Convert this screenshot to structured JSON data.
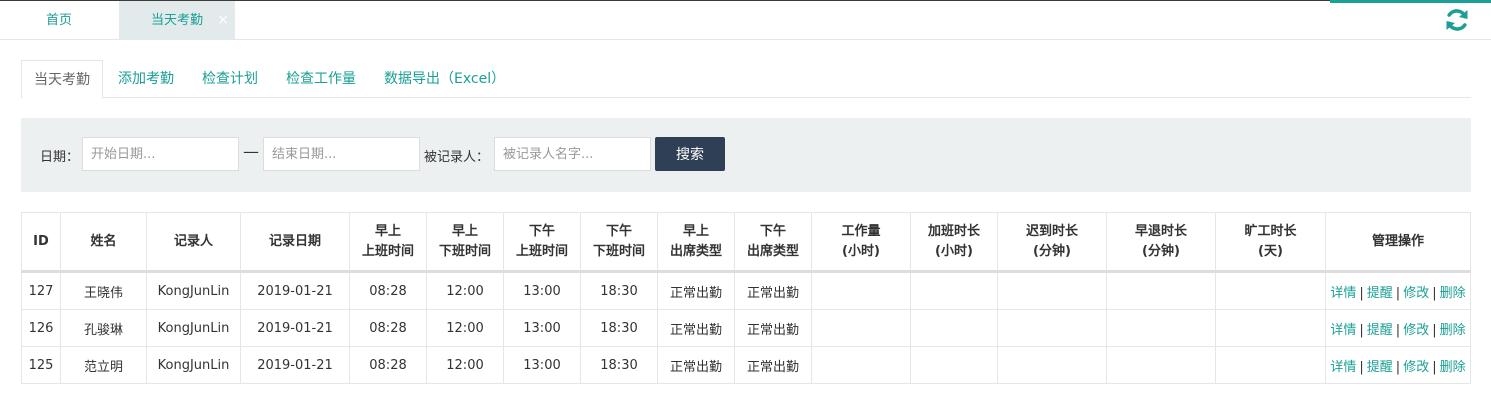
{
  "top_tabs": [
    {
      "label": "首页"
    },
    {
      "label": "当天考勤",
      "close": "×"
    }
  ],
  "sub_tabs": [
    "当天考勤",
    "添加考勤",
    "检查计划",
    "检查工作量",
    "数据导出（Excel）"
  ],
  "search": {
    "date_label": "日期：",
    "start_placeholder": "开始日期...",
    "dash": "—",
    "end_placeholder": "结束日期...",
    "person_label": "被记录人：",
    "person_placeholder": "被记录人名字...",
    "button": "搜索"
  },
  "table": {
    "headers": [
      {
        "l1": "ID",
        "l2": ""
      },
      {
        "l1": "姓名",
        "l2": ""
      },
      {
        "l1": "记录人",
        "l2": ""
      },
      {
        "l1": "记录日期",
        "l2": ""
      },
      {
        "l1": "早上",
        "l2": "上班时间"
      },
      {
        "l1": "早上",
        "l2": "下班时间"
      },
      {
        "l1": "下午",
        "l2": "上班时间"
      },
      {
        "l1": "下午",
        "l2": "下班时间"
      },
      {
        "l1": "早上",
        "l2": "出席类型"
      },
      {
        "l1": "下午",
        "l2": "出席类型"
      },
      {
        "l1": "工作量",
        "l2": "(小时)"
      },
      {
        "l1": "加班时长",
        "l2": "(小时)"
      },
      {
        "l1": "迟到时长",
        "l2": "(分钟)"
      },
      {
        "l1": "早退时长",
        "l2": "(分钟)"
      },
      {
        "l1": "旷工时长",
        "l2": "(天)"
      },
      {
        "l1": "管理操作",
        "l2": ""
      }
    ],
    "rows": [
      {
        "id": "127",
        "name": "王晓伟",
        "recorder": "KongJunLin",
        "date": "2019-01-21",
        "am_in": "08:28",
        "am_out": "12:00",
        "pm_in": "13:00",
        "pm_out": "18:30",
        "am_type": "正常出勤",
        "pm_type": "正常出勤",
        "work": "",
        "overtime": "",
        "late": "",
        "early": "",
        "absent": ""
      },
      {
        "id": "126",
        "name": "孔骏琳",
        "recorder": "KongJunLin",
        "date": "2019-01-21",
        "am_in": "08:28",
        "am_out": "12:00",
        "pm_in": "13:00",
        "pm_out": "18:30",
        "am_type": "正常出勤",
        "pm_type": "正常出勤",
        "work": "",
        "overtime": "",
        "late": "",
        "early": "",
        "absent": ""
      },
      {
        "id": "125",
        "name": "范立明",
        "recorder": "KongJunLin",
        "date": "2019-01-21",
        "am_in": "08:28",
        "am_out": "12:00",
        "pm_in": "13:00",
        "pm_out": "18:30",
        "am_type": "正常出勤",
        "pm_type": "正常出勤",
        "work": "",
        "overtime": "",
        "late": "",
        "early": "",
        "absent": ""
      }
    ],
    "actions": [
      "详情",
      "提醒",
      "修改",
      "删除"
    ],
    "action_sep": "|"
  },
  "colors": {
    "accent": "#1aa094",
    "button": "#2f4056",
    "panel": "#ecf0f1"
  },
  "icons": {
    "refresh": "refresh-icon"
  }
}
